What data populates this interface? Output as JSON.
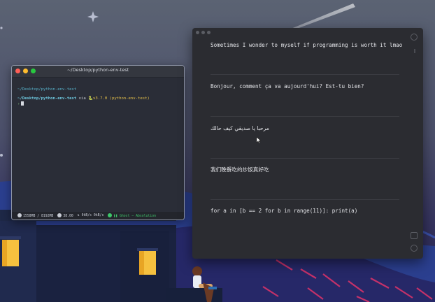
{
  "terminal": {
    "title": "~/Desktop/python-env-test",
    "line1": "~/Desktop/python-env-test",
    "line2_path": "~/Desktop/python-env-test",
    "line2_via": "via",
    "line2_python": "🐍v3.7.0",
    "line2_venv": "(python-env-test)",
    "prompt": "›",
    "status": {
      "memory": "1558MB / 8192MB",
      "temp": "38.00",
      "network": "0kB/s 0kB/s",
      "track": "Ghost – Absolution"
    }
  },
  "notes": {
    "lines": [
      "Sometimes I wonder to myself if programming is worth it lmao",
      "Bonjour, comment ça va aujourd'hui? Est-tu bien?",
      "مرحبا يا صديقي كيف حالك",
      "我们晚餐吃的炒饭真好吃",
      "for a in [b == 2 for b in range(11)]: print(a)"
    ]
  },
  "colors": {
    "sky_top": "#5a6272",
    "sky_bottom": "#2b2850",
    "hills": "#2a3a8a",
    "accent_pink": "#e0336a",
    "terminal_bg": "#2a2d37",
    "notes_bg": "#2b2c31"
  }
}
